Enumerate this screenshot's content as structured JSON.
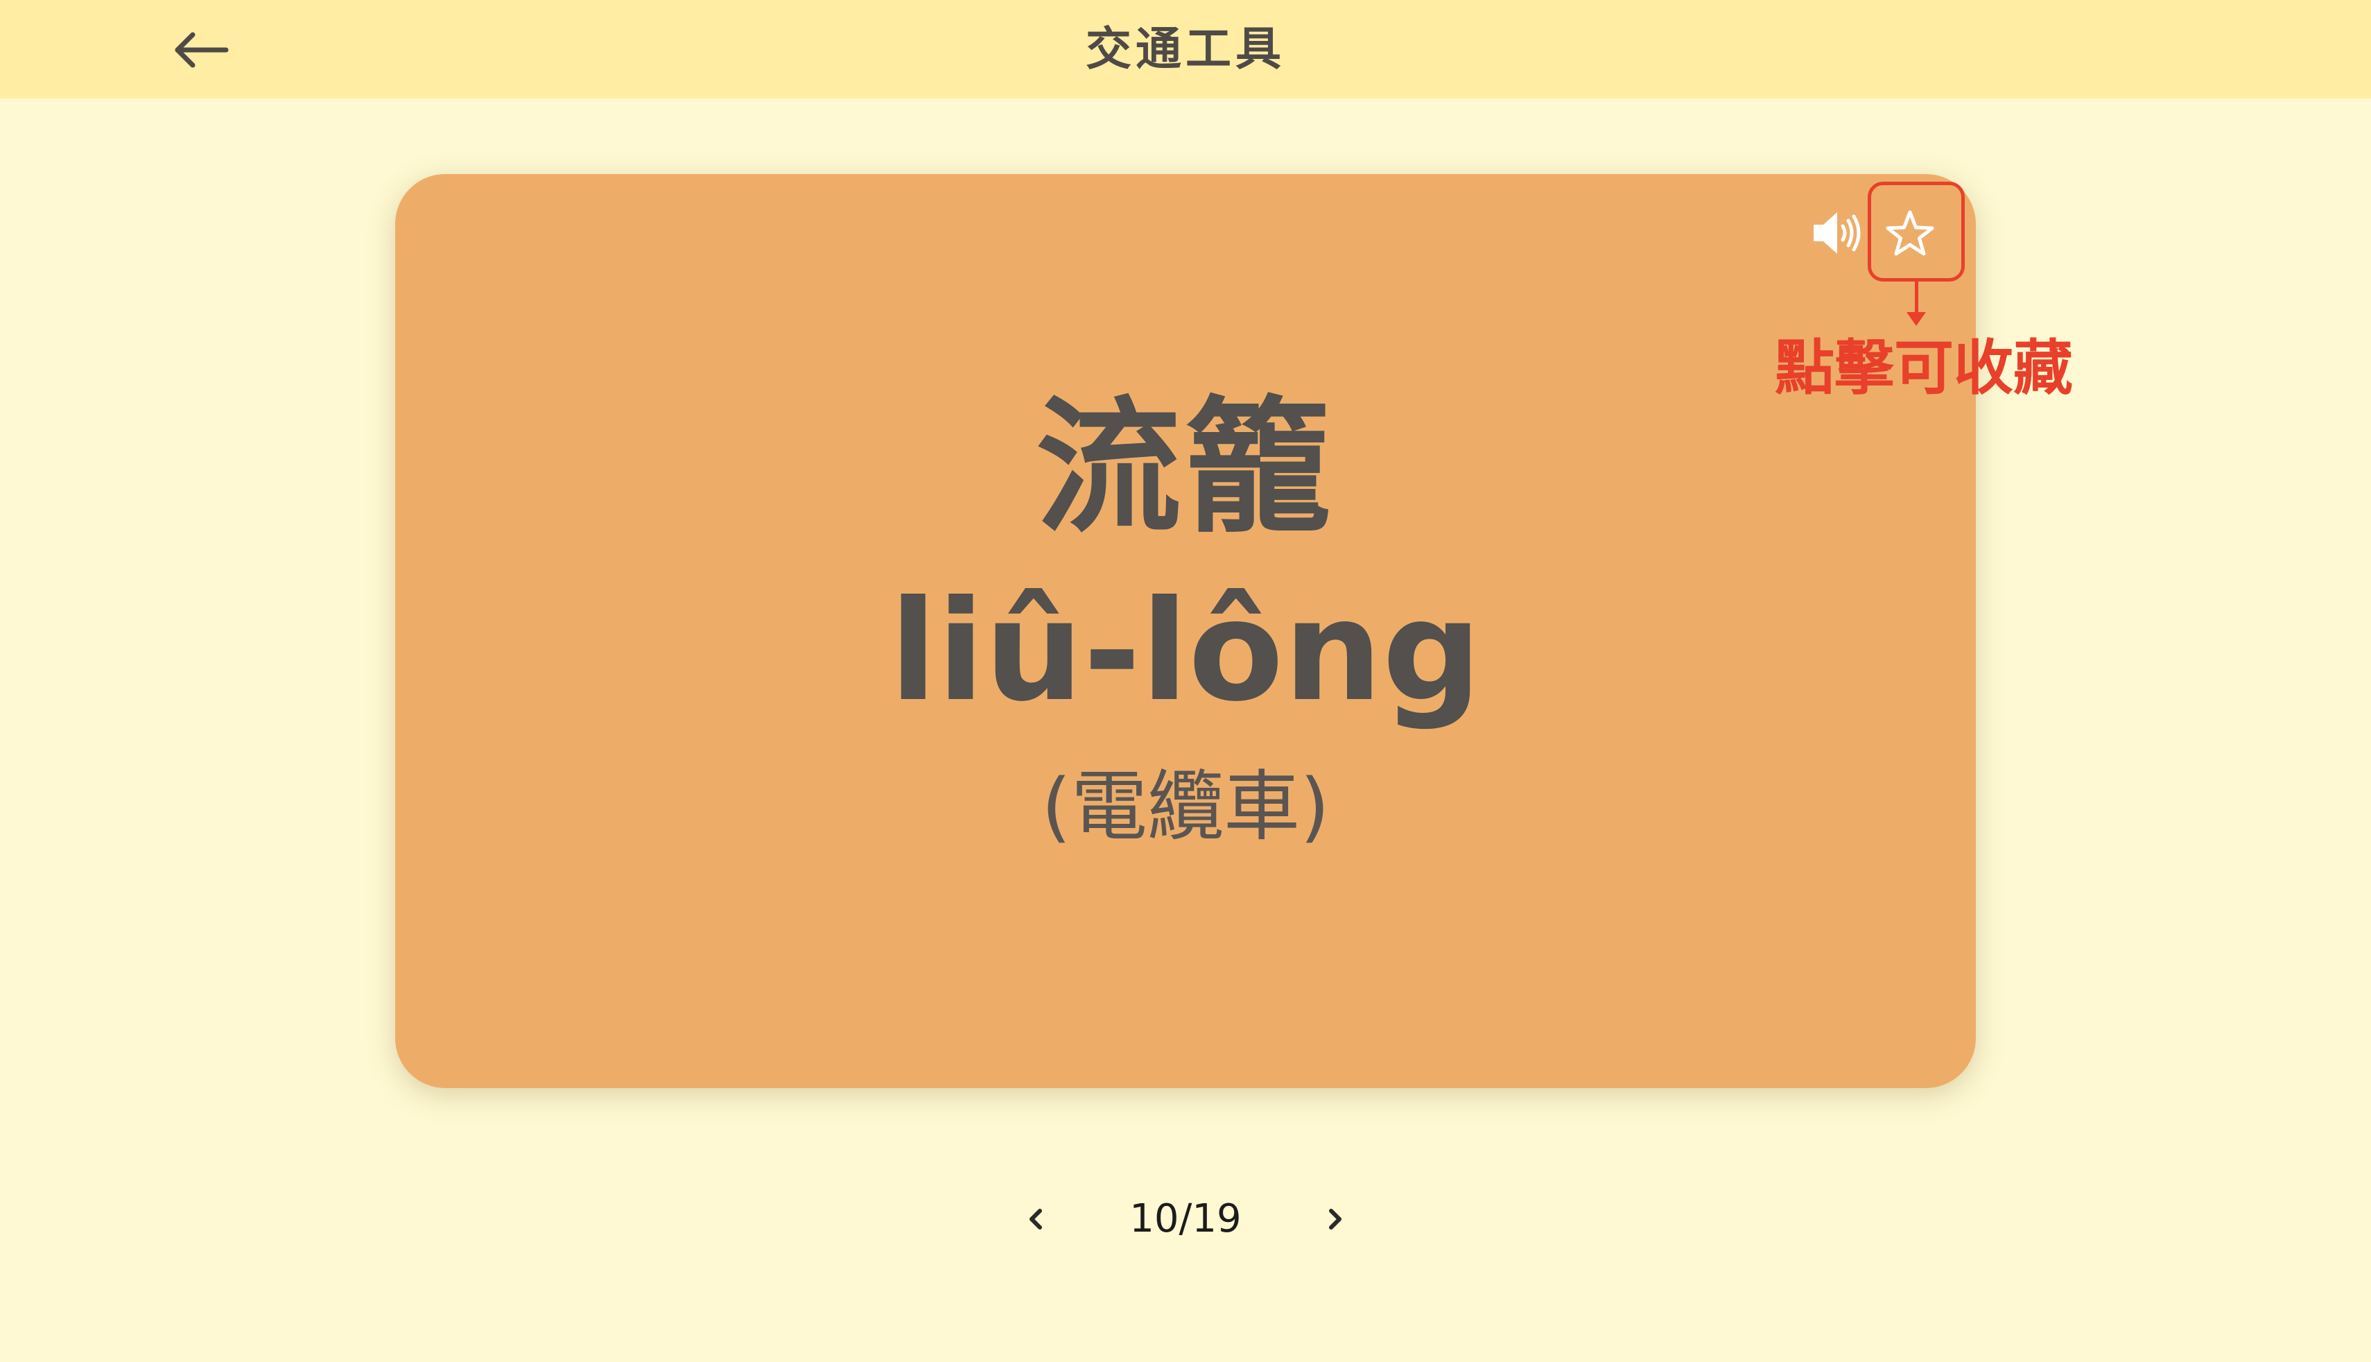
{
  "header": {
    "title": "交通工具",
    "back_icon": "arrow-left-icon"
  },
  "card": {
    "word": "流籠",
    "romanization": "liû-lông",
    "translation": "(電纜車)",
    "background_color": "#edad69",
    "speaker_icon": "speaker-icon",
    "favorite_icon": "star-outline-icon"
  },
  "annotation": {
    "text": "點擊可收藏",
    "color": "#e8402a"
  },
  "pager": {
    "current": "10/19",
    "prev_icon": "chevron-left-icon",
    "next_icon": "chevron-right-icon"
  }
}
